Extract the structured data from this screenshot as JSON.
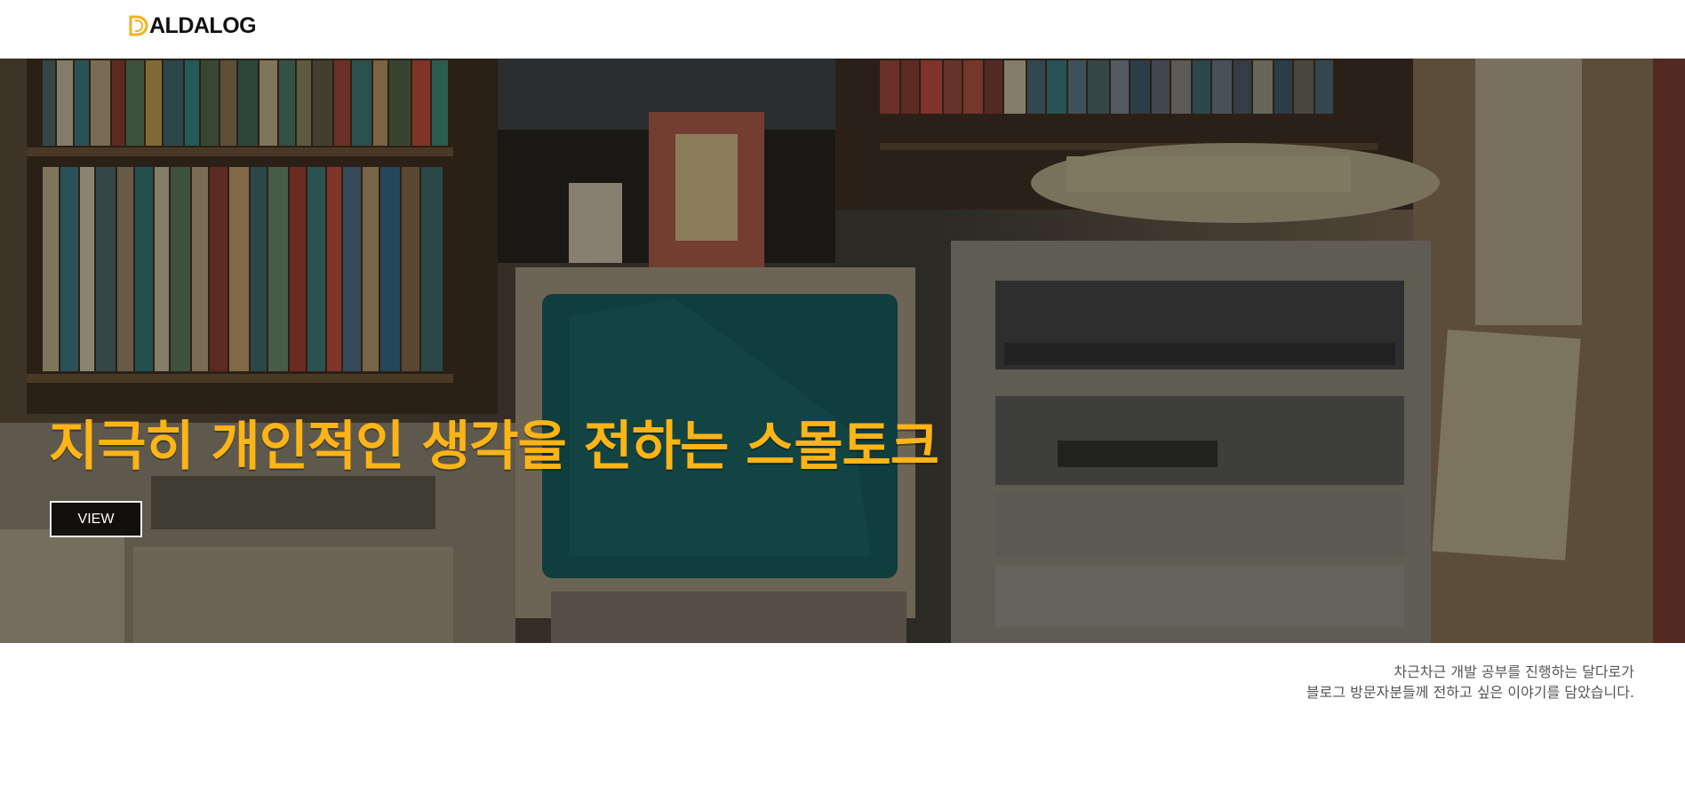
{
  "header": {
    "logo_text": "ALDALOG",
    "logo_mark_color": "#f2b31d"
  },
  "hero": {
    "title": "지극히 개인적인 생각을 전하는 스몰토크",
    "view_label": "VIEW",
    "title_color": "#fdb416"
  },
  "intro": {
    "line1": "차근차근 개발 공부를 진행하는 달다로가",
    "line2": "블로그 방문자분들께 전하고 싶은 이야기를 담았습니다."
  }
}
